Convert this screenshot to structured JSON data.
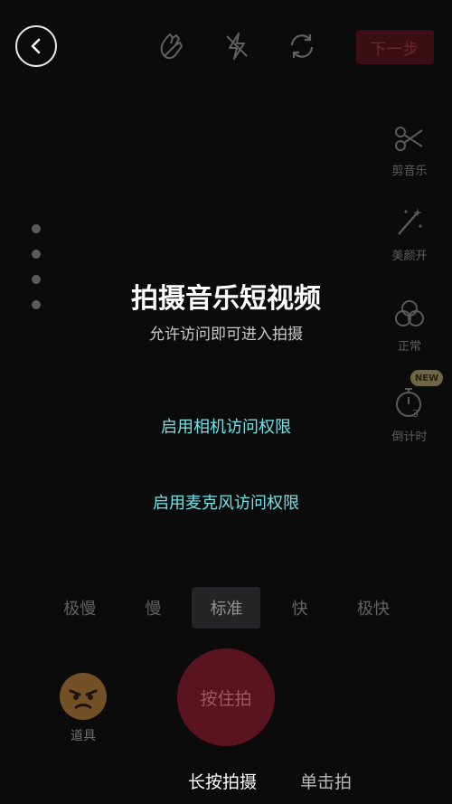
{
  "header": {
    "back_icon": "chevron-left-icon",
    "icons": [
      "hand-wave-icon",
      "flash-off-icon",
      "switch-camera-icon"
    ],
    "next_label": "下一步"
  },
  "side_toolbar": {
    "items": [
      {
        "icon": "scissors-music-icon",
        "label": "剪音乐"
      },
      {
        "icon": "beauty-wand-icon",
        "label": "美颜开"
      },
      {
        "icon": "filter-circles-icon",
        "label": "正常"
      },
      {
        "icon": "countdown-timer-icon",
        "label": "倒计时",
        "badge": "NEW"
      }
    ]
  },
  "main": {
    "title": "拍摄音乐短视频",
    "subtitle": "允许访问即可进入拍摄",
    "camera_permission": "启用相机访问权限",
    "mic_permission": "启用麦克风访问权限"
  },
  "speed_bar": {
    "options": [
      "极慢",
      "慢",
      "标准",
      "快",
      "极快"
    ],
    "selected_index": 2
  },
  "bottom": {
    "props_label": "道具",
    "shoot_label": "按住拍",
    "modes": [
      "长按拍摄",
      "单击拍"
    ]
  },
  "colors": {
    "accent_teal": "#6fe3e6",
    "record_red": "#5a1420",
    "background": "#0b0b0c"
  }
}
